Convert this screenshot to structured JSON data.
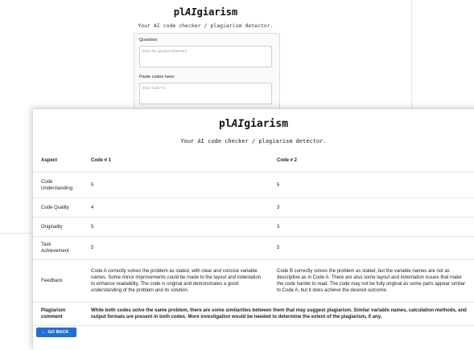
{
  "background_window": {
    "title_prefix": "pl",
    "title_ai": "AI",
    "title_suffix": "giarism",
    "subtitle": "Your AI code checker / plagiarism detector.",
    "question_label": "Question:",
    "question_placeholder": "Enter the question statement",
    "codes_label": "Paste codes here:",
    "code_placeholder": "Enter Code # 1"
  },
  "foreground_window": {
    "title_prefix": "pl",
    "title_ai": "AI",
    "title_suffix": "giarism",
    "subtitle": "Your AI code checker / plagiarism detector.",
    "table": {
      "headers": [
        "Aspect",
        "Code # 1",
        "Code # 2"
      ],
      "rows": [
        {
          "aspect": "Code Understanding",
          "code1": "5",
          "code2": "5"
        },
        {
          "aspect": "Code Quality",
          "code1": "4",
          "code2": "3"
        },
        {
          "aspect": "Originality",
          "code1": "5",
          "code2": "3"
        },
        {
          "aspect": "Task Achievement",
          "code1": "5",
          "code2": "5"
        },
        {
          "aspect": "Feedback",
          "code1": "Code A correctly solves the problem as stated, with clear and concise variable names. Some minor improvements could be made to the layout and indentation to enhance readability. The code is original and demonstrates a good understanding of the problem and its solution.",
          "code2": "Code B correctly solves the problem as stated, but the variable names are not as descriptive as in Code A. There are also some layout and indentation issues that make the code harder to read. The code may not be fully original as some parts appear similar to Code A, but it does achieve the desired outcome."
        }
      ],
      "plagiarism": {
        "aspect": "Plagiarism comment",
        "text": "While both codes solve the same problem, there are some similarities between them that may suggest plagiarism. Similar variable names, calculation methods, and output formats are present in both codes. More investigation would be needed to determine the extent of the plagiarism, if any."
      }
    },
    "go_back_label": "GO BACK"
  }
}
